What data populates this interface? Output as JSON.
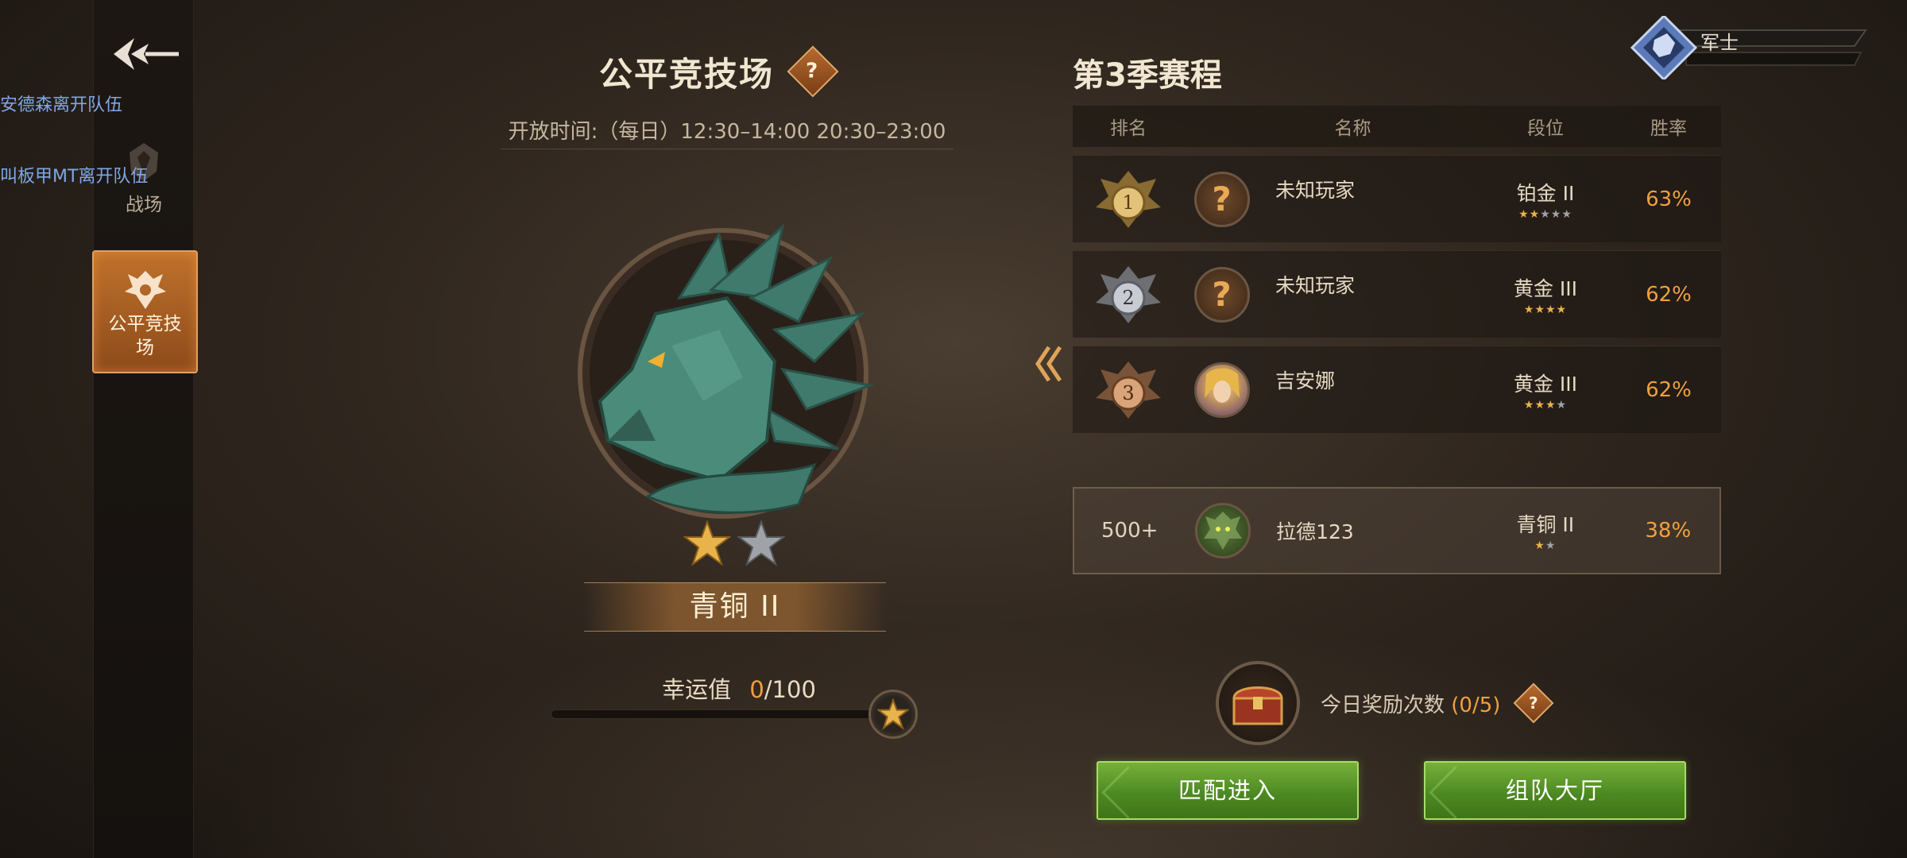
{
  "sidebar": {
    "notices": [
      "安德森离开队伍",
      "叫板甲MT离开队伍"
    ],
    "items": [
      {
        "label": "战场"
      },
      {
        "label_line1": "公平竞技",
        "label_line2": "场"
      }
    ]
  },
  "arena": {
    "title": "公平竞技场",
    "help_symbol": "?",
    "open_time": "开放时间:（每日）12:30–14:00 20:30–23:00",
    "rank_name": "青铜 II",
    "rank_stars_filled": 1,
    "rank_stars_total": 2,
    "luck_label": "幸运值",
    "luck_current": "0",
    "luck_sep_max": "/100",
    "luck_fraction": 0
  },
  "season": {
    "title": "第3季赛程",
    "headers": {
      "rank": "排名",
      "name": "名称",
      "tier": "段位",
      "winrate": "胜率"
    },
    "rows": [
      {
        "rank": "1",
        "avatar": "unknown",
        "name": "未知玩家",
        "tier": "铂金 II",
        "stars": "★★★★★",
        "winrate": "63%"
      },
      {
        "rank": "2",
        "avatar": "unknown",
        "name": "未知玩家",
        "tier": "黄金 III",
        "stars": "★★★★",
        "winrate": "62%"
      },
      {
        "rank": "3",
        "avatar": "elf-portrait",
        "name": "吉安娜",
        "tier": "黄金 III",
        "stars": "★★★★",
        "winrate": "62%"
      }
    ],
    "me": {
      "rank": "500+",
      "avatar": "treant-portrait",
      "name": "拉德123",
      "tier": "青铜 II",
      "stars": "★★",
      "winrate": "38%"
    }
  },
  "reward": {
    "label": "今日奖励次数",
    "count": "(0/5)"
  },
  "buttons": {
    "match": "匹配进入",
    "team_hall": "组队大厅"
  },
  "player": {
    "title": "军士"
  },
  "colors": {
    "accent_orange": "#f0a040",
    "button_green": "#4d8a22"
  }
}
